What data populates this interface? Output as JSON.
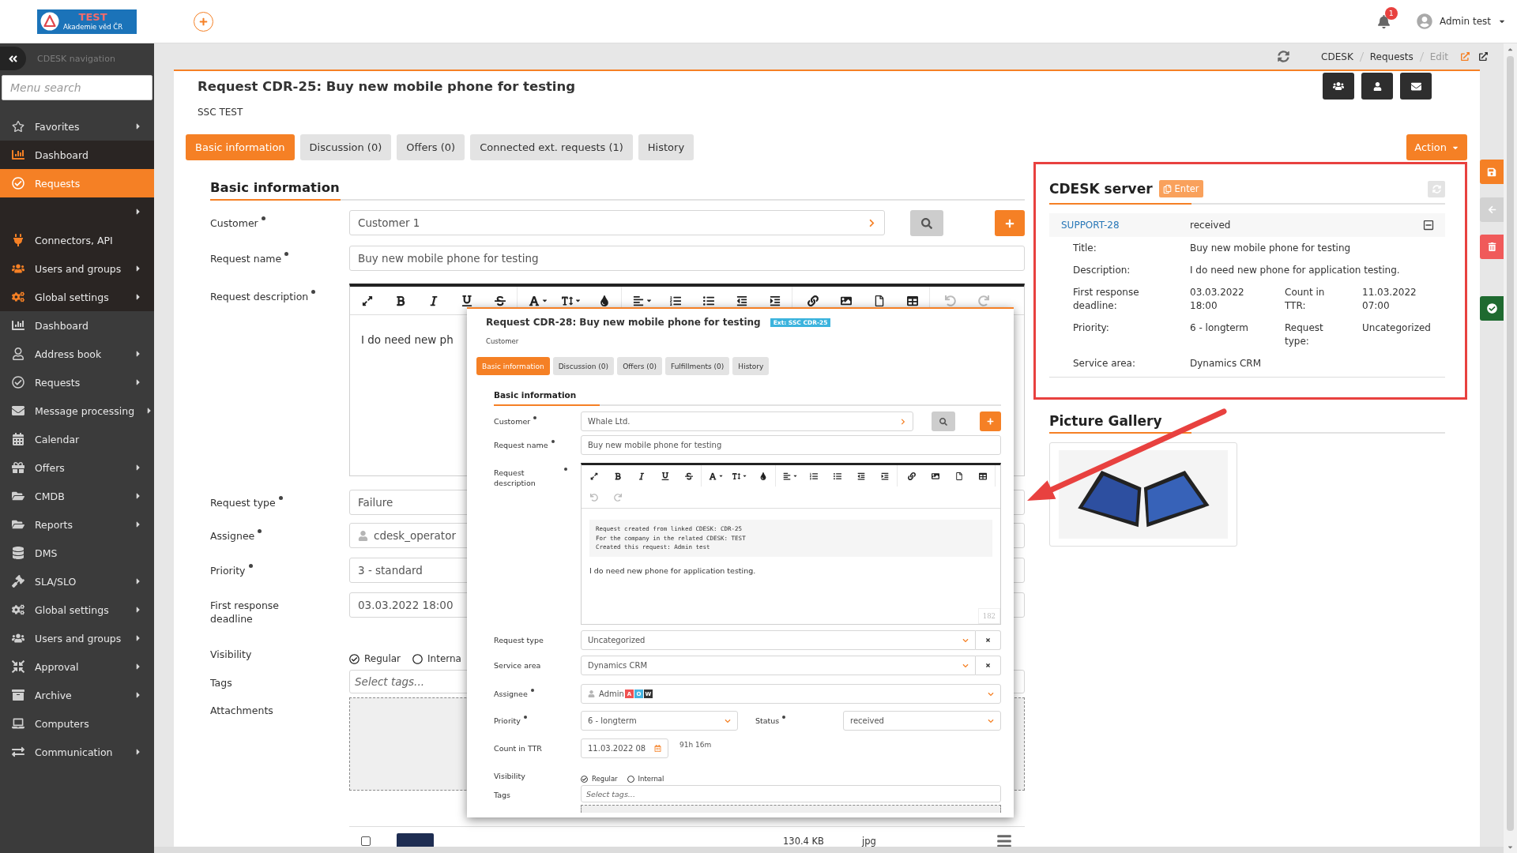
{
  "header": {
    "logo_title": "TEST",
    "logo_subtitle": "Akademie věd ČR",
    "notification_count": "1",
    "user": "Admin test"
  },
  "sidebar": {
    "title": "CDESK navigation",
    "search": {
      "placeholder": "Menu search"
    },
    "favorites": {
      "label": "Favorites",
      "submenu": true,
      "items": [
        {
          "label": "Dashboard",
          "selected": false,
          "submenu": false
        },
        {
          "label": "Requests",
          "selected": true,
          "submenu": false
        },
        {
          "selected": false,
          "submenu": true
        },
        {
          "label": "Connectors, API",
          "selected": false,
          "submenu": false
        },
        {
          "label": "Users and groups",
          "selected": false,
          "submenu": true
        },
        {
          "label": "Global settings",
          "selected": false,
          "submenu": true
        }
      ]
    },
    "items": [
      {
        "label": "Dashboard",
        "selected": false,
        "submenu": false
      },
      {
        "label": "Address book",
        "selected": false,
        "submenu": true
      },
      {
        "label": "Requests",
        "selected": false,
        "submenu": true
      },
      {
        "label": "Message processing",
        "selected": false,
        "submenu": true
      },
      {
        "label": "Calendar",
        "selected": false,
        "submenu": false
      },
      {
        "label": "Offers",
        "selected": false,
        "submenu": true
      },
      {
        "label": "CMDB",
        "selected": false,
        "submenu": true
      },
      {
        "label": "Reports",
        "selected": false,
        "submenu": true
      },
      {
        "label": "DMS",
        "selected": false,
        "submenu": false
      },
      {
        "label": "SLA/SLO",
        "selected": false,
        "submenu": true
      },
      {
        "label": "Global settings",
        "selected": false,
        "submenu": true
      },
      {
        "label": "Users and groups",
        "selected": false,
        "submenu": true
      },
      {
        "label": "Approval",
        "selected": false,
        "submenu": true
      },
      {
        "label": "Archive",
        "selected": false,
        "submenu": true
      },
      {
        "label": "Computers",
        "selected": false,
        "submenu": false
      },
      {
        "label": "Communication",
        "selected": false,
        "submenu": true
      }
    ]
  },
  "breadcrumb": [
    {
      "label": "CDESK",
      "current": false
    },
    {
      "label": "Requests",
      "current": false
    },
    {
      "label": "Edit",
      "current": true
    }
  ],
  "request": {
    "title": "Request CDR-25: Buy new mobile phone for testing",
    "subtitle": "SSC TEST"
  },
  "tabs": [
    {
      "label": "Basic information",
      "selected": true
    },
    {
      "label": "Discussion (0)",
      "selected": false
    },
    {
      "label": "Offers (0)",
      "selected": false
    },
    {
      "label": "Connected ext. requests (1)",
      "selected": false
    },
    {
      "label": "History",
      "selected": false
    }
  ],
  "action_button": "Action",
  "form": {
    "heading": "Basic information",
    "fields": [
      {
        "kind": "lookup",
        "label": "Customer",
        "required": true,
        "value": "Customer 1"
      },
      {
        "kind": "text",
        "label": "Request name",
        "required": true,
        "value": "Buy new mobile phone for testing"
      },
      {
        "kind": "editor",
        "label": "Request description",
        "required": true,
        "value": "I do need new ph"
      },
      {
        "kind": "text",
        "label": "Request type",
        "required": true,
        "value": "Failure"
      },
      {
        "kind": "user",
        "label": "Assignee",
        "required": true,
        "value": "cdesk_operator",
        "dropdown": false
      },
      {
        "kind": "text",
        "label": "Priority",
        "required": true,
        "value": "3 - standard"
      },
      {
        "kind": "text",
        "label": "First response deadline",
        "required": false,
        "value": "03.03.2022 18:00"
      },
      {
        "kind": "radio",
        "label": "Visibility",
        "required": false,
        "options": [
          {
            "label": "Regular",
            "selected": true
          },
          {
            "label": "Interna",
            "selected": false
          }
        ]
      },
      {
        "kind": "tags",
        "label": "Tags",
        "required": false,
        "placeholder": "Select tags..."
      },
      {
        "kind": "dropzone",
        "label": "Attachments",
        "required": false
      }
    ]
  },
  "attachment_table": {
    "rows": [
      {
        "checked": false,
        "size": "130.4 KB",
        "type": "jpg"
      }
    ]
  },
  "linked_request_window": {
    "title": "Request CDR-28: Buy new mobile phone for testing",
    "badge": "Ext: SSC CDR-25",
    "subtitle": "Customer",
    "tabs": [
      {
        "label": "Basic information",
        "selected": true
      },
      {
        "label": "Discussion (0)",
        "selected": false
      },
      {
        "label": "Offers (0)",
        "selected": false
      },
      {
        "label": "Fulfillments (0)",
        "selected": false
      },
      {
        "label": "History",
        "selected": false
      }
    ],
    "heading": "Basic information",
    "fields": [
      {
        "kind": "lookup",
        "label": "Customer",
        "required": true,
        "value": "Whale Ltd."
      },
      {
        "kind": "text",
        "label": "Request name",
        "required": true,
        "value": "Buy new mobile phone for testing"
      },
      {
        "kind": "editor",
        "label": "Request description",
        "required": true,
        "note": [
          "Request created from linked CDESK: CDR-25",
          "For the company in the related CDESK: TEST",
          "Created this request: Admin test"
        ],
        "value": "I do need new phone for application testing.",
        "counter": "182"
      },
      {
        "kind": "select",
        "label": "Request type",
        "required": false,
        "value": "Uncategorized",
        "clearable": true
      },
      {
        "kind": "select",
        "label": "Service area",
        "required": false,
        "value": "Dynamics CRM",
        "clearable": true
      },
      {
        "kind": "user",
        "label": "Assignee",
        "required": true,
        "value": "Admin",
        "dropdown": true,
        "badges": [
          {
            "label": "A",
            "color": "#f05252"
          },
          {
            "label": "O",
            "color": "#45b3e0"
          },
          {
            "label": "W",
            "color": "#333333"
          }
        ]
      },
      {
        "kind": "pair",
        "label": "Priority",
        "required": true,
        "value": "6 - longterm",
        "second": {
          "label": "Status",
          "required": true,
          "value": "received"
        }
      },
      {
        "kind": "date",
        "label": "Count in TTR",
        "required": false,
        "value": "11.03.2022 08",
        "note": "91h 16m"
      },
      {
        "kind": "radio",
        "label": "Visibility",
        "required": false,
        "options": [
          {
            "label": "Regular",
            "selected": true
          },
          {
            "label": "Internal",
            "selected": false
          }
        ]
      },
      {
        "kind": "tags",
        "label": "Tags",
        "required": false,
        "placeholder": "Select tags..."
      },
      {
        "kind": "dropzone"
      }
    ]
  },
  "linked_server": {
    "title": "CDESK server",
    "enter_button": "Enter",
    "request": {
      "id": "SUPPORT-28",
      "status": "received",
      "expanded": true
    },
    "details": [
      {
        "label": "Title:",
        "value": "Buy new mobile phone for testing"
      },
      {
        "label": "Description:",
        "value": "I do need new phone for application testing."
      },
      {
        "label": "First response deadline:",
        "value": "03.03.2022 18:00",
        "extra_label": "Count in TTR:",
        "extra_value": "11.03.2022 07:00"
      },
      {
        "label": "Priority:",
        "value": "6 - longterm",
        "extra_label": "Request type:",
        "extra_value": "Uncategorized"
      },
      {
        "label": "Service area:",
        "value": "Dynamics CRM"
      }
    ]
  },
  "picture_gallery": {
    "title": "Picture Gallery"
  }
}
